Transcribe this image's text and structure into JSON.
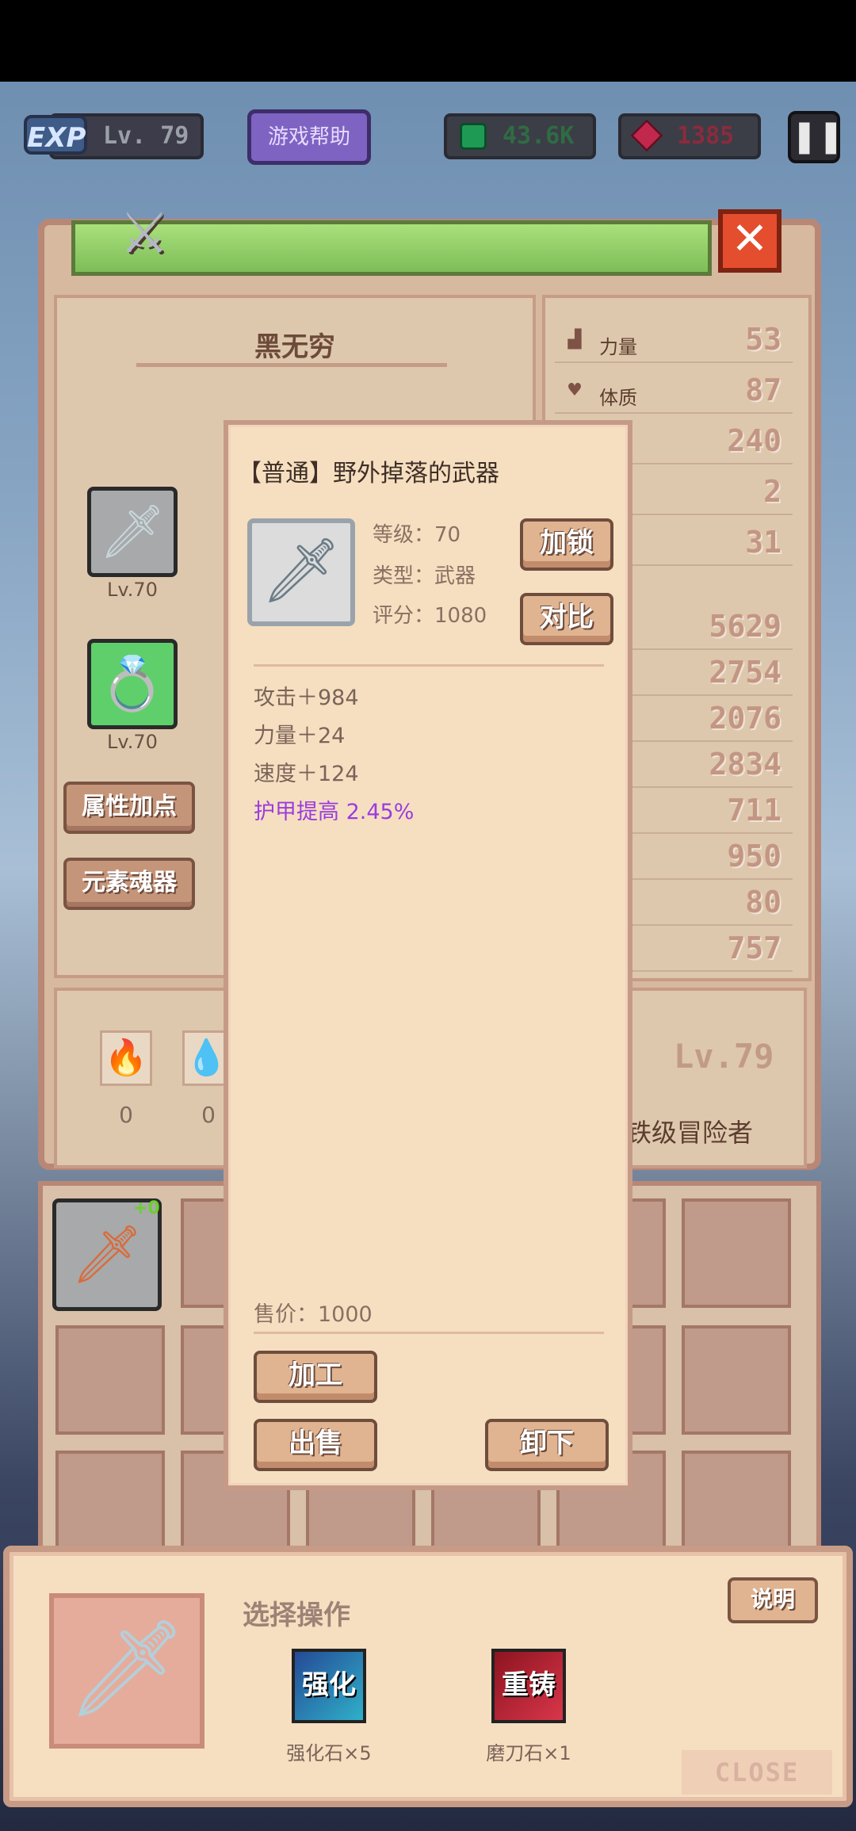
{
  "hud": {
    "exp_badge": "EXP",
    "level": "Lv. 79",
    "help_button": "游戏帮助",
    "gems": "43.6K",
    "rubies": "1385",
    "pause_icon": "pause-icon"
  },
  "character": {
    "name": "黑无穷",
    "equipment": [
      {
        "icon": "sword-icon",
        "level": "Lv.70"
      },
      {
        "icon": "ring-icon",
        "level": "Lv.70"
      }
    ],
    "buttons": {
      "attr_points": "属性加点",
      "element_soul": "元素魂器"
    },
    "elements": [
      {
        "icon": "fire-element-icon",
        "count": "0"
      },
      {
        "icon": "water-element-icon",
        "count": "0"
      }
    ],
    "player_level": "Lv.79",
    "rank_partial": "铁级冒险者",
    "stats_top": [
      {
        "label": "力量",
        "value": "53",
        "icon": "strength-icon"
      },
      {
        "label": "体质",
        "value": "87",
        "icon": "heart-icon"
      },
      {
        "label": "",
        "value": "240"
      },
      {
        "label": "",
        "value": "2"
      },
      {
        "label": "",
        "value": "31"
      }
    ],
    "stats_bottom": [
      "5629",
      "2754",
      "2076",
      "2834",
      "711",
      "950",
      "80",
      "757"
    ]
  },
  "inventory": {
    "first_item_plus": "+0"
  },
  "item_detail": {
    "title": "【普通】野外掉落的武器",
    "level_line": "等级：70",
    "type_line": "类型：武器",
    "score_line": "评分：1080",
    "lock_button": "加锁",
    "compare_button": "对比",
    "attributes": [
      "攻击＋984",
      "力量＋24",
      "速度＋124"
    ],
    "special_attribute": "护甲提高 2.45%",
    "price": "售价：1000",
    "process_button": "加工",
    "sell_button": "出售",
    "unequip_button": "卸下"
  },
  "operation_panel": {
    "title": "选择操作",
    "explain_button": "说明",
    "enhance_icon_text": "强化",
    "enhance_caption": "强化石×5",
    "reforge_icon_text": "重铸",
    "reforge_caption": "磨刀石×1",
    "close_label": "CLOSE"
  },
  "colors": {
    "panel_bg": "#f6dfc0",
    "panel_border": "#c79b86",
    "button_bg": "#e0b491",
    "special_attr": "#9a3ce0"
  }
}
